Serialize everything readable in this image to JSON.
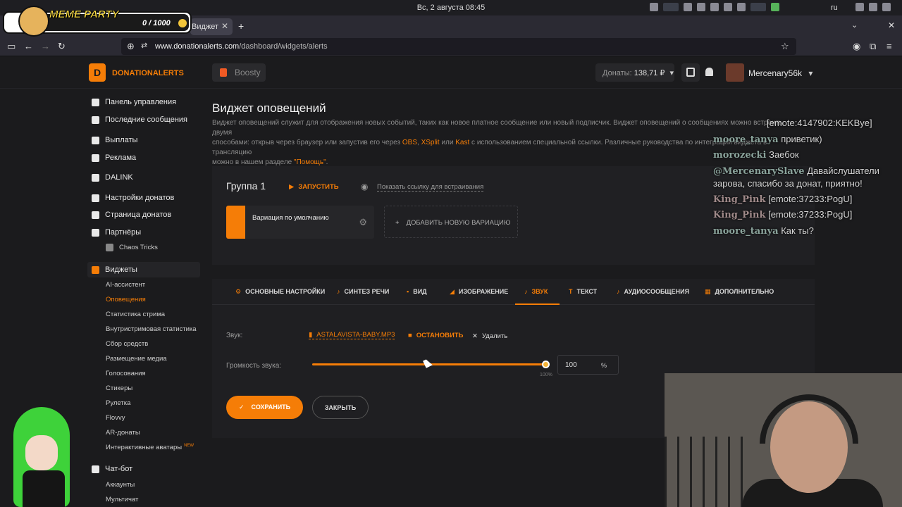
{
  "system": {
    "clock": "Вс, 2 августа  08:45",
    "lang": "ru"
  },
  "browser": {
    "tab_title": "Виджет",
    "new_tab_icon": "plus-icon",
    "url_domain": "www.donationalerts.com",
    "url_path": "/dashboard/widgets/alerts"
  },
  "overlay_meme": {
    "title": "MEME PARTY",
    "counter": "0 / 1000"
  },
  "header": {
    "brand": "DONATIONALERTS",
    "boosty": "Boosty",
    "donats_label": "Донаты:",
    "donats_value": "138,71 ₽",
    "username": "Mercenary56k"
  },
  "sidebar": {
    "items": [
      {
        "label": "Панель управления",
        "icon": "dashboard-icon"
      },
      {
        "label": "Последние сообщения",
        "icon": "messages-icon"
      },
      {
        "label": "Выплаты",
        "icon": "payout-icon"
      },
      {
        "label": "Реклама",
        "icon": "ad-icon"
      },
      {
        "label": "DALINK",
        "icon": "link-icon"
      },
      {
        "label": "Настройки донатов",
        "icon": "settings-icon"
      },
      {
        "label": "Страница донатов",
        "icon": "page-icon"
      },
      {
        "label": "Партнёры",
        "icon": "partners-icon"
      },
      {
        "label": "Chaos Tricks",
        "icon": "chaos-icon"
      },
      {
        "label": "Виджеты",
        "icon": "widgets-icon"
      },
      {
        "label": "Чат-бот",
        "icon": "chatbot-icon"
      }
    ],
    "widgets_sub": [
      "AI-ассистент",
      "Оповещения",
      "Статистика стрима",
      "Внутристримовая статистика",
      "Сбор средств",
      "Размещение медиа",
      "Голосования",
      "Стикеры",
      "Рулетка",
      "Flovvy",
      "AR-донаты",
      "Интерактивные аватары"
    ],
    "new_badge": "NEW",
    "chatbot_sub": [
      "Аккаунты",
      "Мультичат"
    ]
  },
  "main": {
    "title": "Виджет оповещений",
    "desc_1": "Виджет оповещений служит для отображения новых событий, таких как новое платное сообщение или новый подписчик. Виджет оповещений о сообщениях можно встроить двумя",
    "desc_2a": "способами: открыв через браузер или запустив его через ",
    "desc_obs": "OBS",
    "desc_c1": ", ",
    "desc_xsplit": "XSplit",
    "desc_or": " или ",
    "desc_kast": "Kast",
    "desc_2b": " с использованием специальной ссылки. Различные руководства по интеграции виджета в трансляцию",
    "desc_3a": "можно в нашем разделе ",
    "desc_help": "\"Помощь\"",
    "desc_3b": "."
  },
  "group": {
    "name": "Группа 1",
    "launch": "ЗАПУСТИТЬ",
    "embed_link": "Показать ссылку для встраивания",
    "variation": "Вариация по умолчанию",
    "add_variation": "ДОБАВИТЬ НОВУЮ ВАРИАЦИЮ"
  },
  "tabs": [
    "ОСНОВНЫЕ НАСТРОЙКИ",
    "СИНТЕЗ РЕЧИ",
    "ВИД",
    "ИЗОБРАЖЕНИЕ",
    "ЗВУК",
    "ТЕКСТ",
    "АУДИОСООБЩЕНИЯ",
    "ДОПОЛНИТЕЛЬНО"
  ],
  "active_tab": "ЗВУК",
  "sound": {
    "label": "Звук:",
    "file": "ASTALAVISTA-BABY.MP3",
    "stop": "ОСТАНОВИТЬ",
    "delete": "Удалить",
    "volume_label": "Громкость звука:",
    "slider_max_label": "100%",
    "volume_value": "100",
    "volume_unit": "%",
    "volume_fraction": 1.0
  },
  "actions": {
    "save": "СОХРАНИТЬ",
    "close": "ЗАКРЫТЬ"
  },
  "chat": [
    {
      "user": "",
      "text": "[emote:4147902:KEKBye]"
    },
    {
      "user": "moore_tanya",
      "text": "приветик)"
    },
    {
      "user": "morozecki",
      "text": "Заебок"
    },
    {
      "user": "@MercenarySlave",
      "text": "Давайслушатели"
    },
    {
      "user": "",
      "text": "зарова, спасибо за донат, приятно!"
    },
    {
      "user": "King_Pink",
      "text": "[emote:37233:PogU]"
    },
    {
      "user": "King_Pink",
      "text": "[emote:37233:PogU]"
    },
    {
      "user": "moore_tanya",
      "text": "Как ты?"
    }
  ],
  "colors": {
    "accent": "#f57d07",
    "bg": "#1b1b1d",
    "panel": "#202023",
    "chat_user": "#8aa39b"
  }
}
